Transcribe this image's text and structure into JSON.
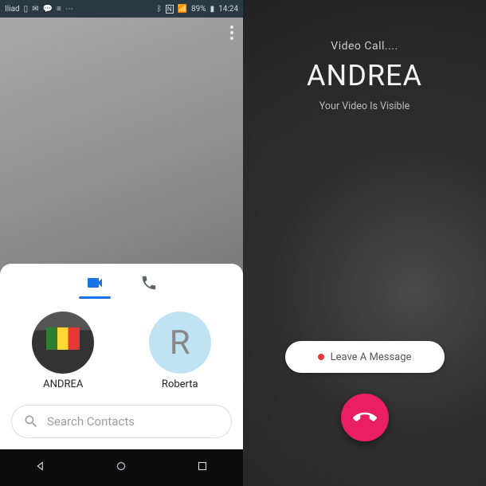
{
  "left": {
    "statusbar": {
      "carrier": "Iliad",
      "battery": "89%",
      "time": "14:24"
    },
    "tabs": {
      "video_icon": "video-call-tab",
      "audio_icon": "audio-call-tab"
    },
    "contacts": [
      {
        "name": "ANDREA",
        "avatar_kind": "flag"
      },
      {
        "name": "Roberta",
        "avatar_kind": "letter",
        "letter": "R"
      }
    ],
    "search_placeholder": "Search Contacts"
  },
  "right": {
    "status": "Video Call....",
    "caller": "ANDREA",
    "visibility": "Your Video Is Visible",
    "leave_message_label": "Leave A Message"
  }
}
